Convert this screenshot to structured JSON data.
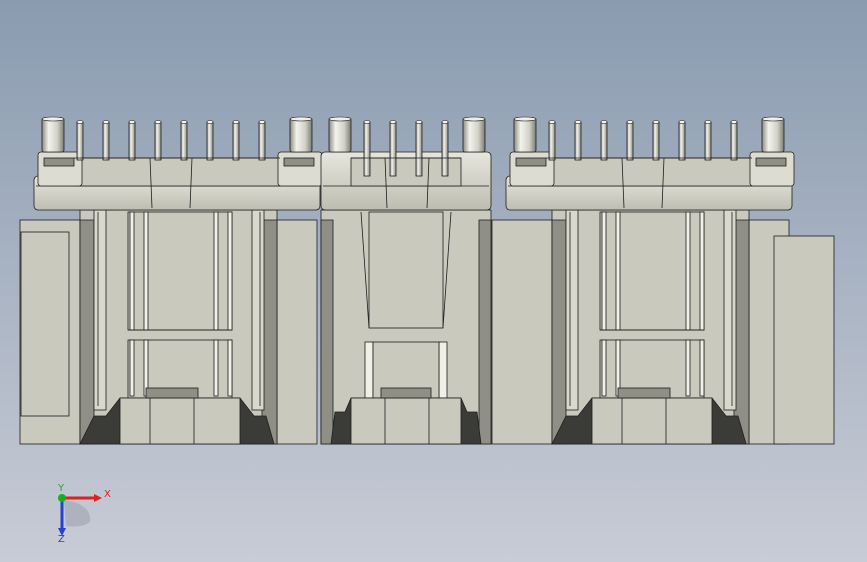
{
  "viewport": {
    "background_top": "#8a9bb0",
    "background_bottom": "#c8ccd6"
  },
  "model": {
    "body_color": "#c9c9bd",
    "shadow_color": "#8f8f86",
    "dark_color": "#3b3b37",
    "edge_color": "#1e1e1e",
    "pin_color": "#d2d2c8",
    "connectors": [
      {
        "name": "left-connector",
        "variant": "wide"
      },
      {
        "name": "middle-connector",
        "variant": "narrow"
      },
      {
        "name": "right-connector",
        "variant": "wide"
      }
    ]
  },
  "triad": {
    "x_label": "X",
    "y_label": "Y",
    "z_label": "Z",
    "x_color": "#e02020",
    "y_color": "#18b018",
    "z_color": "#2a3fd0"
  }
}
